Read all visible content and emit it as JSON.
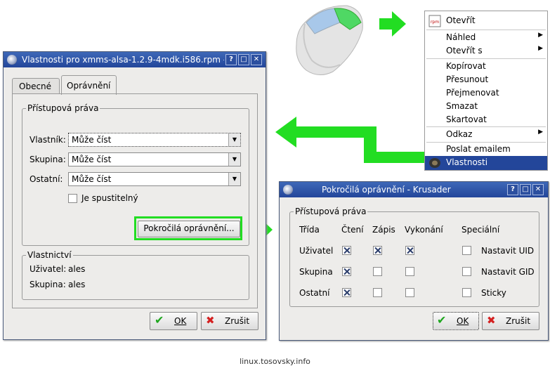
{
  "properties_dialog": {
    "title": "Vlastnosti pro xmms-alsa-1.2.9-4mdk.i586.rpm - Krı",
    "tabs": [
      "Obecné",
      "Oprávnění"
    ],
    "access_group_title": "Přístupová práva",
    "owner_label": "Vlastník:",
    "owner_value": "Může číst",
    "group_label": "Skupina:",
    "group_value": "Může číst",
    "others_label": "Ostatní:",
    "others_value": "Může číst",
    "executable_label": "Je spustitelný",
    "advanced_button": "Pokročilá oprávnění...",
    "ownership_group_title": "Vlastnictví",
    "user_label": "Uživatel:",
    "user_value": "ales",
    "group2_label": "Skupina:",
    "group2_value": "ales",
    "ok_button": "OK",
    "cancel_button": "Zrušit"
  },
  "advanced_dialog": {
    "title": "Pokročilá oprávnění - Krusader",
    "group_title": "Přístupová práva",
    "columns": [
      "Třída",
      "Čtení",
      "Zápis",
      "Vykonání",
      "Speciální"
    ],
    "rows": [
      {
        "name": "Uživatel",
        "read": true,
        "write": true,
        "exec": true,
        "special": "Nastavit UID"
      },
      {
        "name": "Skupina",
        "read": true,
        "write": false,
        "exec": false,
        "special": "Nastavit GID"
      },
      {
        "name": "Ostatní",
        "read": true,
        "write": false,
        "exec": false,
        "special": "Sticky"
      }
    ],
    "ok_button": "OK",
    "cancel_button": "Zrušit"
  },
  "context_menu": {
    "items": [
      {
        "label": "Otevřít",
        "icon": "rpm-icon"
      },
      {
        "label": "Náhled",
        "submenu": true
      },
      {
        "label": "Otevřít s",
        "submenu": true
      },
      {
        "label": "Kopírovat"
      },
      {
        "label": "Přesunout"
      },
      {
        "label": "Přejmenovat"
      },
      {
        "label": "Smazat"
      },
      {
        "label": "Skartovat"
      },
      {
        "label": "Odkaz",
        "submenu": true
      },
      {
        "label": "Poslat emailem"
      },
      {
        "label": "Vlastnosti",
        "icon": "properties-icon",
        "selected": true
      }
    ]
  },
  "footer": "linux.tosovsky.info",
  "colors": {
    "titlebar": "#2c4f9f",
    "highlight": "#23469a",
    "arrow": "#22dd22"
  }
}
